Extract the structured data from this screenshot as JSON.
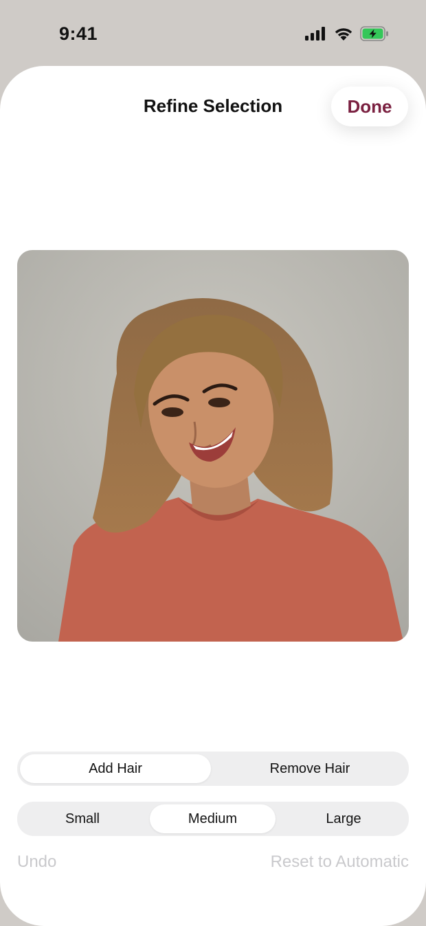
{
  "status_bar": {
    "time": "9:41",
    "icons": [
      "cellular-signal-icon",
      "wifi-icon",
      "battery-charging-icon"
    ],
    "battery_color": "#34c759"
  },
  "header": {
    "title": "Refine Selection",
    "done_label": "Done",
    "accent_color": "#7a2040"
  },
  "photo": {
    "subject": "portrait-photo"
  },
  "hair_mode": {
    "options": [
      "Add Hair",
      "Remove Hair"
    ],
    "selected": "Add Hair"
  },
  "brush_size": {
    "options": [
      "Small",
      "Medium",
      "Large"
    ],
    "selected": "Medium"
  },
  "footer": {
    "undo_label": "Undo",
    "reset_label": "Reset to Automatic"
  }
}
